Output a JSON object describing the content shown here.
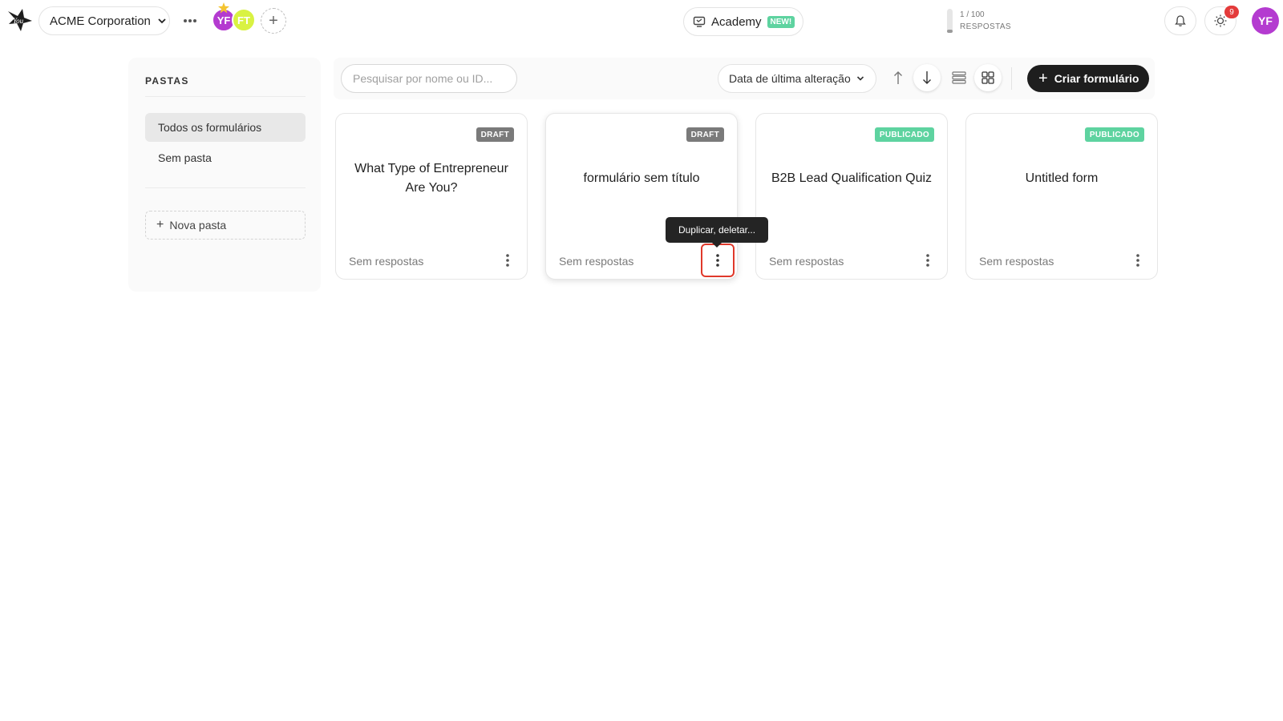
{
  "topbar": {
    "workspace": "ACME Corporation",
    "members": [
      "YF",
      "FT"
    ],
    "academy_label": "Academy",
    "academy_badge": "NEW!",
    "usage_count": "1 / 100",
    "usage_label": "RESPOSTAS",
    "usage_fraction": 0.01,
    "notifications_count": "9",
    "user_initials": "YF"
  },
  "sidebar": {
    "title": "PASTAS",
    "items": [
      {
        "label": "Todos os formulários",
        "active": true
      },
      {
        "label": "Sem pasta",
        "active": false
      }
    ],
    "new_folder_label": "Nova pasta"
  },
  "toolbar": {
    "search_placeholder": "Pesquisar por nome ou ID...",
    "sort_label": "Data de última alteração",
    "create_label": "Criar formulário"
  },
  "forms": [
    {
      "title": "What Type of Entrepreneur Are You?",
      "status": "DRAFT",
      "responses": "Sem respostas"
    },
    {
      "title": "formulário sem título",
      "status": "DRAFT",
      "responses": "Sem respostas"
    },
    {
      "title": "B2B Lead Qualification Quiz",
      "status": "PUBLICADO",
      "responses": "Sem respostas"
    },
    {
      "title": "Untitled form",
      "status": "PUBLICADO",
      "responses": "Sem respostas"
    }
  ],
  "tooltip": "Duplicar, deletar...",
  "colors": {
    "accent_green": "#5ed3a0",
    "avatar_purple": "#b43bd0",
    "avatar_lime": "#d9f242",
    "highlight_red": "#e0392b",
    "notification_red": "#e43b3b"
  },
  "icons": [
    "logo-icon",
    "chevron-down-icon",
    "more-dots-icon",
    "star-icon",
    "plus-icon",
    "academy-icon",
    "bell-icon",
    "bulb-icon",
    "arrow-up-icon",
    "arrow-down-icon",
    "list-view-icon",
    "grid-view-icon",
    "kebab-icon"
  ]
}
